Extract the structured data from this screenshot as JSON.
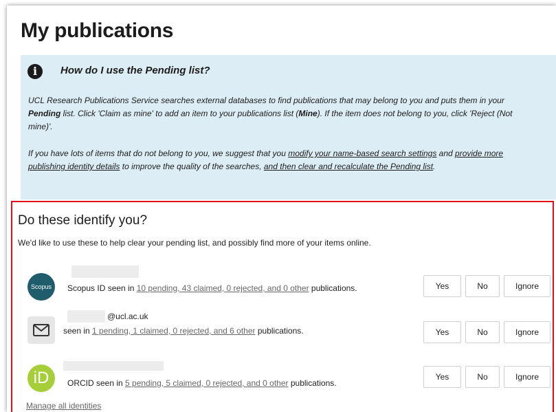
{
  "page_title": "My publications",
  "info": {
    "heading": "How do I use the Pending list?",
    "p1_a": "UCL Research Publications Service searches external databases to find publications that may belong to you and puts them in your ",
    "p1_pending": "Pending",
    "p1_b": " list. Click 'Claim as mine' to add an item to your publications list (",
    "p1_mine": "Mine",
    "p1_c": "). If the item does not belong to you, click 'Reject (Not mine)'.",
    "p2_a": "If you have lots of items that do not belong to you, we suggest that you ",
    "p2_link1": "modify your name-based search settings",
    "p2_b": " and ",
    "p2_link2": "provide more publishing identity details",
    "p2_c": " to improve the quality of the searches, ",
    "p2_link3": "and then clear and recalculate the Pending list",
    "p2_d": "."
  },
  "identify": {
    "title": "Do these identify you?",
    "subtitle": "We'd like to use these to help clear your pending list, and possibly find more of your items online.",
    "rows": [
      {
        "icon": "scopus-icon",
        "badge_text": "Scopus",
        "prefix": "Scopus ID seen in ",
        "link": "10 pending, 43 claimed, 0 rejected, and 0 other",
        "suffix": " publications."
      },
      {
        "icon": "envelope-icon",
        "domain": "@ucl.ac.uk",
        "prefix": "seen in ",
        "link": "1 pending, 1 claimed, 0 rejected, and 6 other",
        "suffix": " publications."
      },
      {
        "icon": "orcid-icon",
        "badge_text": "iD",
        "prefix": "ORCID seen in ",
        "link": "5 pending, 5 claimed, 0 rejected, and 0 other",
        "suffix": " publications."
      }
    ],
    "yes_label": "Yes",
    "no_label": "No",
    "ignore_label": "Ignore",
    "manage_label": "Manage all identities"
  },
  "colors": {
    "info_bg": "#dcedf6",
    "highlight_border": "#e0101a",
    "scopus": "#1f5c6c",
    "orcid": "#a6ce39"
  }
}
